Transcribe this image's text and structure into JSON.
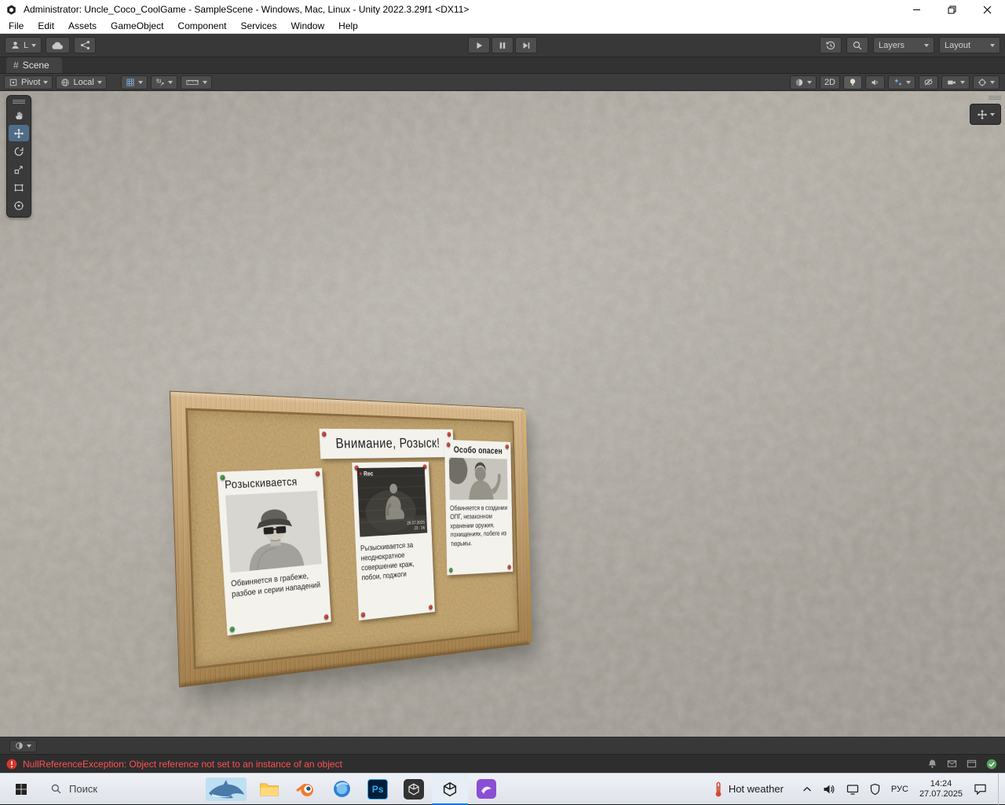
{
  "titlebar": {
    "title": "Administrator: Uncle_Coco_CoolGame - SampleScene - Windows, Mac, Linux - Unity 2022.3.29f1 <DX11>"
  },
  "menubar": {
    "items": [
      "File",
      "Edit",
      "Assets",
      "GameObject",
      "Component",
      "Services",
      "Window",
      "Help"
    ]
  },
  "toolbar": {
    "account_label": "L",
    "layers_label": "Layers",
    "layout_label": "Layout"
  },
  "scene_tab": {
    "icon": "#",
    "label": "Scene"
  },
  "scene_toolbar": {
    "pivot_label": "Pivot",
    "local_label": "Local",
    "two_d_label": "2D"
  },
  "board": {
    "header": "Внимание, Розыск!",
    "poster_left": {
      "title": "Розыскивается",
      "body": "Обвиняется в грабеже, разбое и серии нападений"
    },
    "poster_middle": {
      "rec_label": "Rec",
      "cam_date": "25.07.2025",
      "cam_time": "23 : 36",
      "body": "Рызыскивается за неоднократное совершение краж, побои, поджоги"
    },
    "poster_right": {
      "title": "Особо опасен",
      "body": "Обвиняется в создании ОПГ, незаконном хранении оружия, похищениях, побеге из тюрьмы."
    }
  },
  "statusbar": {
    "error": "NullReferenceException: Object reference not set to an instance of an object"
  },
  "taskbar": {
    "search_label": "Поиск",
    "photoshop_label": "Ps",
    "weather_label": "Hot weather",
    "language_label": "РУС",
    "time": "14:24",
    "date": "27.07.2025"
  },
  "colors": {
    "accent_blue": "#0078d7",
    "error_red": "#ff5050",
    "wood": "#c79b5c",
    "cork": "#bd9d66",
    "pin_red": "#b23228",
    "pin_green": "#3c8a34",
    "photoshop_blue": "#31a8ff",
    "blender_orange": "#f5792a"
  },
  "icons": {
    "unity_logo": "hexagon-cube",
    "account": "person-circle",
    "cloud": "cloud",
    "play": "triangle-right",
    "pause": "double-bar",
    "step": "triangle-with-bar",
    "history": "clock-arrow",
    "search": "magnifier",
    "hand_tool": "hand",
    "move_tool": "cross-arrows",
    "rotate_tool": "circular-arrow",
    "scale_tool": "square-diagonal-arrow",
    "rect_tool": "rectangle-corner-dots",
    "transform_tool": "circle-orbit-dots",
    "error": "red-circle-exclamation",
    "start": "windows-panes",
    "notification": "speech-bubble"
  }
}
